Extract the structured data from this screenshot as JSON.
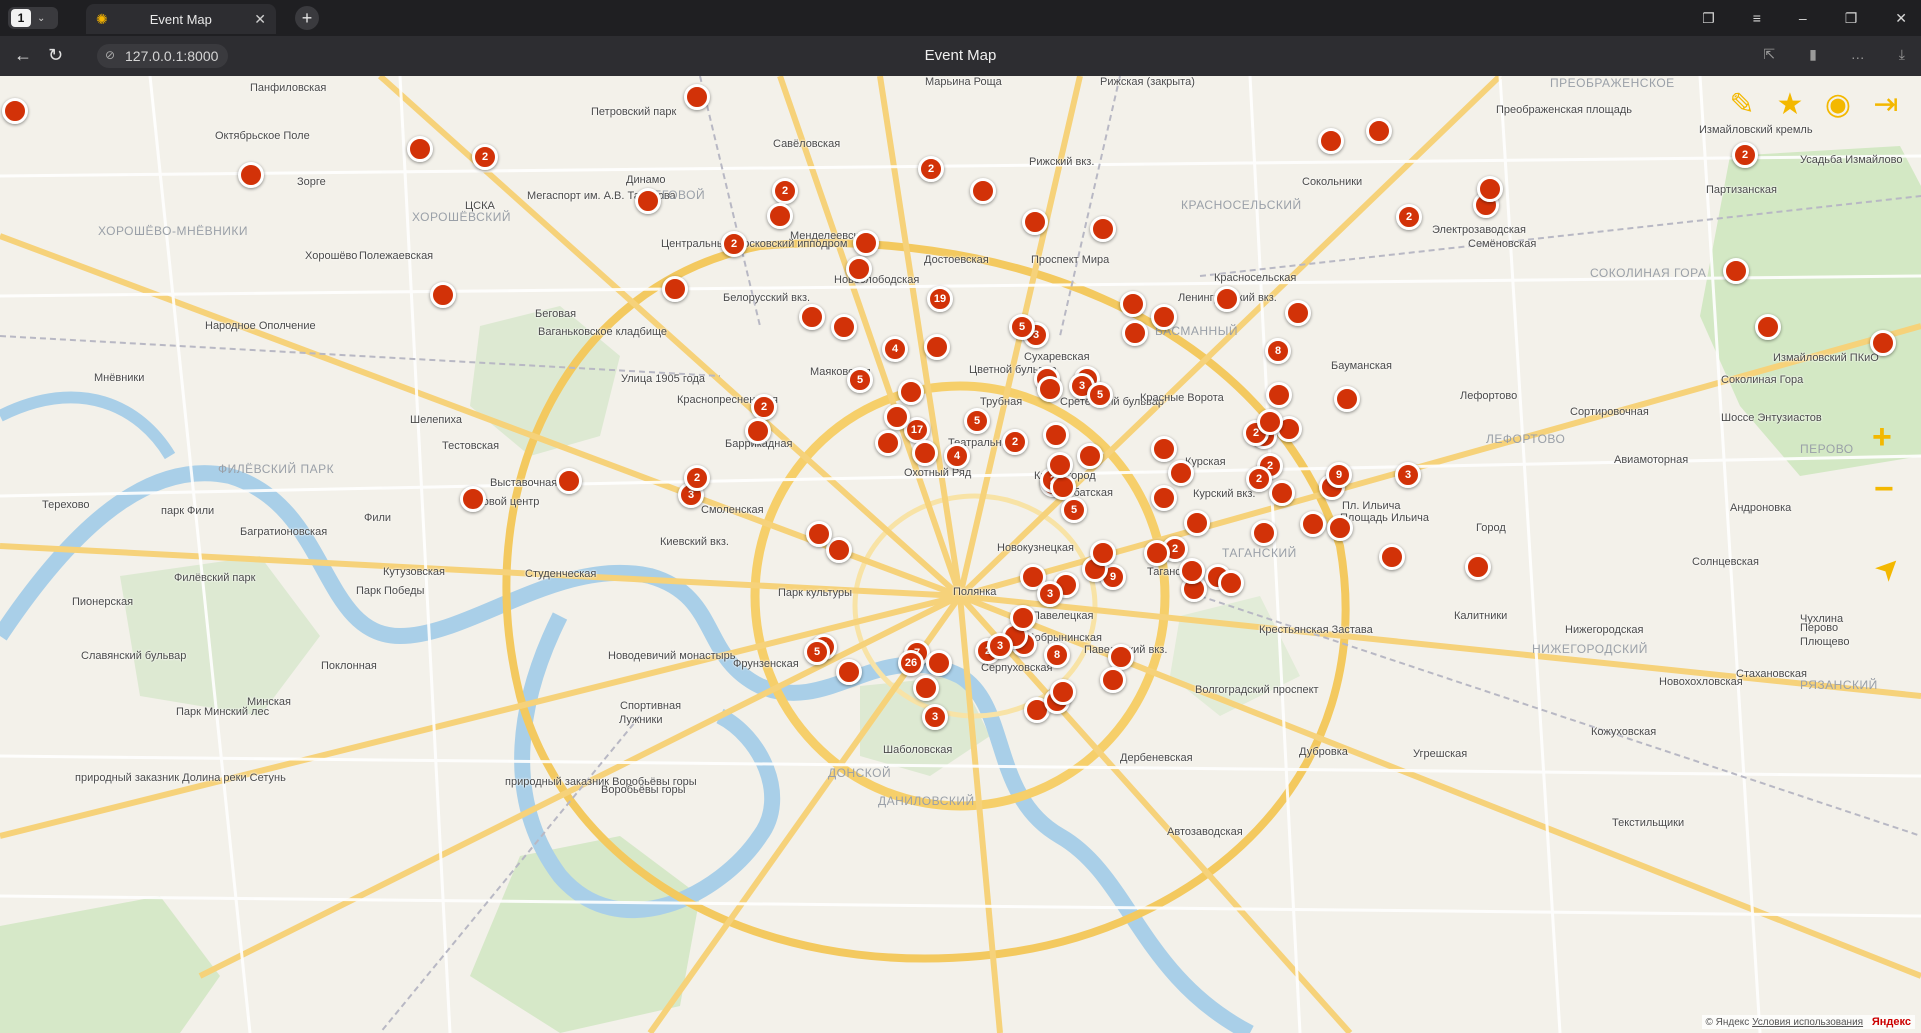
{
  "browser": {
    "tab_count": "1",
    "tab_title": "Event Map",
    "url": "127.0.0.1:8000",
    "page_title": "Event Map"
  },
  "map": {
    "labels": [
      {
        "text": "Панфиловская"
      },
      {
        "text": "Октябрьское Поле"
      },
      {
        "text": "Зорге"
      },
      {
        "text": "ЦСКА"
      },
      {
        "text": "Мегаспорт им. А.В. Тарасова"
      },
      {
        "text": "Петровский парк"
      },
      {
        "text": "Динамо"
      },
      {
        "text": "Савёловская"
      },
      {
        "text": "Марьина Роща"
      },
      {
        "text": "Рижская (закрыта)"
      },
      {
        "text": "Рижский вкз."
      },
      {
        "text": "Преображенская площадь"
      },
      {
        "text": "Сокольники"
      },
      {
        "text": "Измайловский кремль"
      },
      {
        "text": "Партизанская"
      },
      {
        "text": "Усадьба Измайлово"
      },
      {
        "text": "Менделеевская"
      },
      {
        "text": "Достоевская"
      },
      {
        "text": "Проспект Мира"
      },
      {
        "text": "Электрозаводская"
      },
      {
        "text": "Семёновская"
      },
      {
        "text": "Новослободская"
      },
      {
        "text": "Полежаевская"
      },
      {
        "text": "Хорошёво"
      },
      {
        "text": "Центральный Московский ипподром"
      },
      {
        "text": "Белорусский вкз."
      },
      {
        "text": "Красносельская"
      },
      {
        "text": "Ленинградский вкз."
      },
      {
        "text": "Народное Ополчение"
      },
      {
        "text": "Беговая"
      },
      {
        "text": "Цветной бульвар"
      },
      {
        "text": "Сухаревская"
      },
      {
        "text": "Бауманская"
      },
      {
        "text": "Измайловский ПКиО"
      },
      {
        "text": "Соколиная Гора"
      },
      {
        "text": "Ваганьковское кладбище"
      },
      {
        "text": "Маяковская"
      },
      {
        "text": "Трубная"
      },
      {
        "text": "Сретенский бульвар"
      },
      {
        "text": "Красные Ворота"
      },
      {
        "text": "Лефортово"
      },
      {
        "text": "Сортировочная"
      },
      {
        "text": "Мнёвники"
      },
      {
        "text": "Улица 1905 года"
      },
      {
        "text": "Баррикадная"
      },
      {
        "text": "Краснопресненская"
      },
      {
        "text": "Театральная"
      },
      {
        "text": "Китай-город"
      },
      {
        "text": "Курская"
      },
      {
        "text": "Курский вкз."
      },
      {
        "text": "Шоссе Энтузиастов"
      },
      {
        "text": "Шелепиха"
      },
      {
        "text": "Тестовская"
      },
      {
        "text": "Арбатская"
      },
      {
        "text": "Охотный Ряд"
      },
      {
        "text": "Авиамоторная"
      },
      {
        "text": "Выставочная"
      },
      {
        "text": "Деловой центр"
      },
      {
        "text": "Смоленская"
      },
      {
        "text": "Пл. Ильича"
      },
      {
        "text": "Площадь Ильича"
      },
      {
        "text": "Город"
      },
      {
        "text": "Андроновка"
      },
      {
        "text": "Терехово"
      },
      {
        "text": "парк Фили"
      },
      {
        "text": "Фили"
      },
      {
        "text": "Багратионовская"
      },
      {
        "text": "Киевский вкз."
      },
      {
        "text": "Новокузнецкая"
      },
      {
        "text": "Таганская"
      },
      {
        "text": "Филёвский парк"
      },
      {
        "text": "Пионерская"
      },
      {
        "text": "Кутузовская"
      },
      {
        "text": "Студенческая"
      },
      {
        "text": "Парк Победы"
      },
      {
        "text": "Полянка"
      },
      {
        "text": "Павелецкая"
      },
      {
        "text": "Крестьянская Застава"
      },
      {
        "text": "Калитники"
      },
      {
        "text": "Нижегородская"
      },
      {
        "text": "Чухлина"
      },
      {
        "text": "Перово"
      },
      {
        "text": "Плющево"
      },
      {
        "text": "Славянский бульвар"
      },
      {
        "text": "Поклонная"
      },
      {
        "text": "Парк культуры"
      },
      {
        "text": "Добрынинская"
      },
      {
        "text": "Павелецкий вкз."
      },
      {
        "text": "Серпуховская"
      },
      {
        "text": "Волгоградский проспект"
      },
      {
        "text": "Стахановская"
      },
      {
        "text": "Новохохловская"
      },
      {
        "text": "Минская"
      },
      {
        "text": "Парк Минский лес"
      },
      {
        "text": "Новодевичий монастырь"
      },
      {
        "text": "Спортивная"
      },
      {
        "text": "Лужники"
      },
      {
        "text": "Фрунзенская"
      },
      {
        "text": "Шаболовская"
      },
      {
        "text": "Дубровка"
      },
      {
        "text": "Угрешская"
      },
      {
        "text": "Дербеневская"
      },
      {
        "text": "природный заказник Долина реки Сетунь"
      },
      {
        "text": "природный заказник Воробьёвы горы"
      },
      {
        "text": "Воробьёвы горы"
      },
      {
        "text": "Текстильщики"
      },
      {
        "text": "Автозаводская"
      },
      {
        "text": "Кожуховская"
      },
      {
        "text": "Солнцевская"
      }
    ],
    "districts": [
      {
        "text": "ХОРОШЁВСКИЙ"
      },
      {
        "text": "БЕГОВОЙ"
      },
      {
        "text": "ХОРОШЁВО-МНЁВНИКИ"
      },
      {
        "text": "ПРЕОБРАЖЕНСКОЕ"
      },
      {
        "text": "КРАСНОСЕЛЬСКИЙ"
      },
      {
        "text": "СОКОЛИНАЯ ГОРА"
      },
      {
        "text": "БАСМАННЫЙ"
      },
      {
        "text": "ЛЕФОРТОВО"
      },
      {
        "text": "ФИЛЁВСКИЙ ПАРК"
      },
      {
        "text": "ТАГАНСКИЙ"
      },
      {
        "text": "НИЖЕГОРОДСКИЙ"
      },
      {
        "text": "РЯЗАНСКИЙ"
      },
      {
        "text": "ДОНСКОЙ"
      },
      {
        "text": "ДАНИЛОВСКИЙ"
      },
      {
        "text": "ПЕРОВО"
      }
    ],
    "markers": [
      {
        "count": ""
      },
      {
        "count": ""
      },
      {
        "count": "2"
      },
      {
        "count": ""
      },
      {
        "count": ""
      },
      {
        "count": ""
      },
      {
        "count": "2"
      },
      {
        "count": "2"
      },
      {
        "count": ""
      },
      {
        "count": "2"
      },
      {
        "count": ""
      },
      {
        "count": ""
      },
      {
        "count": ""
      },
      {
        "count": ""
      },
      {
        "count": ""
      },
      {
        "count": ""
      },
      {
        "count": "2"
      },
      {
        "count": ""
      },
      {
        "count": ""
      },
      {
        "count": "2"
      },
      {
        "count": "19"
      },
      {
        "count": ""
      },
      {
        "count": ""
      },
      {
        "count": ""
      },
      {
        "count": ""
      },
      {
        "count": ""
      },
      {
        "count": "4"
      },
      {
        "count": ""
      },
      {
        "count": ""
      },
      {
        "count": "3"
      },
      {
        "count": ""
      },
      {
        "count": ""
      },
      {
        "count": ""
      },
      {
        "count": "8"
      },
      {
        "count": ""
      },
      {
        "count": ""
      },
      {
        "count": "5"
      },
      {
        "count": ""
      },
      {
        "count": ""
      },
      {
        "count": ""
      },
      {
        "count": "2"
      },
      {
        "count": "3"
      },
      {
        "count": ""
      },
      {
        "count": ""
      },
      {
        "count": ""
      },
      {
        "count": ""
      },
      {
        "count": "2"
      },
      {
        "count": "5"
      },
      {
        "count": "5"
      },
      {
        "count": ""
      },
      {
        "count": "17"
      },
      {
        "count": "5"
      },
      {
        "count": ""
      },
      {
        "count": ""
      },
      {
        "count": ""
      },
      {
        "count": "2"
      },
      {
        "count": "4"
      },
      {
        "count": ""
      },
      {
        "count": "2"
      },
      {
        "count": ""
      },
      {
        "count": "2"
      },
      {
        "count": ""
      },
      {
        "count": ""
      },
      {
        "count": "9"
      },
      {
        "count": ""
      },
      {
        "count": ""
      },
      {
        "count": ""
      },
      {
        "count": "2"
      },
      {
        "count": ""
      },
      {
        "count": ""
      },
      {
        "count": ""
      },
      {
        "count": ""
      },
      {
        "count": "2"
      },
      {
        "count": ""
      },
      {
        "count": "3"
      },
      {
        "count": "2"
      },
      {
        "count": ""
      },
      {
        "count": ""
      },
      {
        "count": "9"
      },
      {
        "count": ""
      },
      {
        "count": ""
      },
      {
        "count": ""
      },
      {
        "count": ""
      },
      {
        "count": "2"
      },
      {
        "count": ""
      },
      {
        "count": ""
      },
      {
        "count": "5"
      },
      {
        "count": ""
      },
      {
        "count": ""
      },
      {
        "count": "3"
      },
      {
        "count": "7"
      },
      {
        "count": "7"
      },
      {
        "count": ""
      },
      {
        "count": "26"
      },
      {
        "count": ""
      },
      {
        "count": ""
      },
      {
        "count": "5"
      },
      {
        "count": "3"
      },
      {
        "count": "2"
      },
      {
        "count": ""
      },
      {
        "count": ""
      },
      {
        "count": ""
      },
      {
        "count": ""
      },
      {
        "count": ""
      },
      {
        "count": ""
      },
      {
        "count": ""
      },
      {
        "count": ""
      },
      {
        "count": "3"
      },
      {
        "count": ""
      },
      {
        "count": "8"
      },
      {
        "count": ""
      },
      {
        "count": ""
      },
      {
        "count": ""
      },
      {
        "count": ""
      },
      {
        "count": ""
      },
      {
        "count": ""
      },
      {
        "count": "2"
      },
      {
        "count": ""
      },
      {
        "count": "3"
      },
      {
        "count": ""
      }
    ],
    "controls": {
      "edit_icon": "edit-icon",
      "favorites_icon": "star-icon",
      "profile_icon": "user-icon",
      "logout_icon": "logout-icon",
      "zoom_in": "+",
      "zoom_out": "−",
      "locate_icon": "location-arrow-icon",
      "accent_color": "#f3b800",
      "marker_color": "#d23208"
    },
    "copyright": {
      "text": "© Яндекс",
      "terms": "Условия использования",
      "brand": "Яндекс"
    }
  }
}
